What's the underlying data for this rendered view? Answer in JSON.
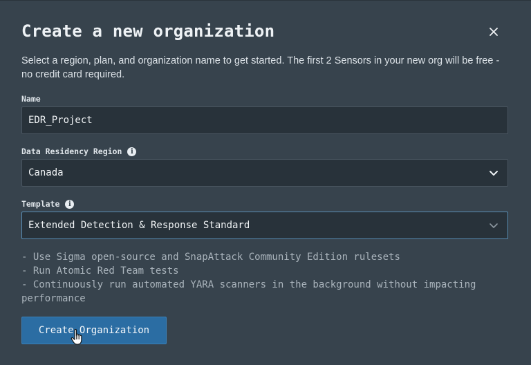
{
  "modal": {
    "title": "Create a new organization",
    "description": "Select a region, plan, and organization name to get started. The first 2 Sensors in your new org will be free - no credit card required."
  },
  "form": {
    "name": {
      "label": "Name",
      "value": "EDR_Project"
    },
    "region": {
      "label": "Data Residency Region",
      "value": "Canada"
    },
    "template": {
      "label": "Template",
      "value": "Extended Detection & Response Standard"
    }
  },
  "template_notes": [
    "- Use Sigma open-source and SnapAttack Community Edition rulesets",
    "- Run Atomic Red Team tests",
    "- Continuously run automated YARA scanners in the background without impacting performance"
  ],
  "submit": {
    "label": "Create Organization"
  },
  "colors": {
    "background": "#37434d",
    "primary_button": "#2b6da3",
    "field_bg": "#28323a"
  },
  "icons": [
    "close-icon",
    "info-icon",
    "chevron-down-icon",
    "hand-pointer-cursor"
  ]
}
